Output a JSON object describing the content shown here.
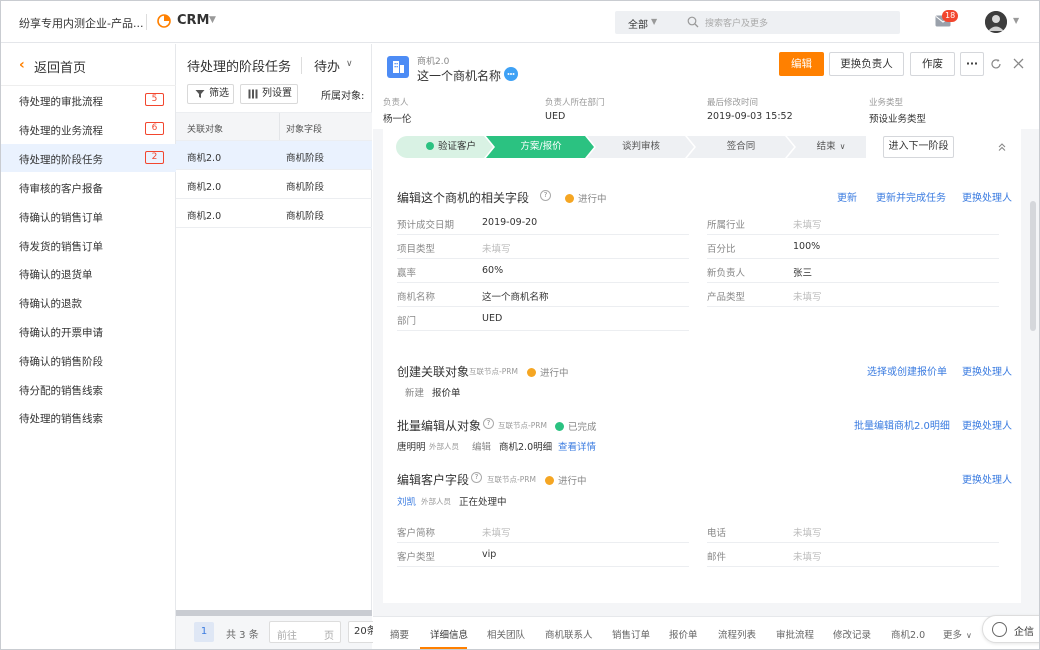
{
  "topbar": {
    "company": "纷享专用内测企业-产品...",
    "app_name": "CRM",
    "search_scope": "全部",
    "search_placeholder": "搜索客户及更多",
    "mail_badge": "18"
  },
  "sidebar": {
    "back_label": "返回首页",
    "items": [
      {
        "label": "待处理的审批流程",
        "badge": "5"
      },
      {
        "label": "待处理的业务流程",
        "badge": "6"
      },
      {
        "label": "待处理的阶段任务",
        "badge": "2"
      },
      {
        "label": "待审核的客户报备"
      },
      {
        "label": "待确认的销售订单"
      },
      {
        "label": "待发货的销售订单"
      },
      {
        "label": "待确认的退货单"
      },
      {
        "label": "待确认的退款"
      },
      {
        "label": "待确认的开票申请"
      },
      {
        "label": "待确认的销售阶段"
      },
      {
        "label": "待分配的销售线索"
      },
      {
        "label": "待处理的销售线索"
      }
    ],
    "active_index": 2
  },
  "list": {
    "title": "待处理的阶段任务",
    "filter_label": "待办",
    "filter_btn": "筛选",
    "column_btn": "列设置",
    "belong_label": "所属对象:",
    "columns": [
      "关联对象",
      "对象字段"
    ],
    "rows": [
      [
        "商机2.0",
        "商机阶段"
      ],
      [
        "商机2.0",
        "商机阶段"
      ],
      [
        "商机2.0",
        "商机阶段"
      ]
    ],
    "pager": {
      "page": "1",
      "total": "共 3 条",
      "goto_placeholder": "前往",
      "page_unit": "页",
      "page_size": "20条"
    }
  },
  "detail": {
    "object_type": "商机2.0",
    "object_name": "这一个商机名称",
    "actions": {
      "edit": "编辑",
      "change_owner": "更换负责人",
      "void": "作废",
      "more": "···"
    },
    "meta": [
      {
        "k": "负责人",
        "v": "杨一伦"
      },
      {
        "k": "负责人所在部门",
        "v": "UED"
      },
      {
        "k": "最后修改时间",
        "v": "2019-09-03 15:52"
      },
      {
        "k": "业务类型",
        "v": "预设业务类型"
      }
    ],
    "stages": [
      "验证客户",
      "方案/报价",
      "谈判审核",
      "签合同",
      "结束"
    ],
    "next_stage": "进入下一阶段",
    "section1": {
      "title": "编辑这个商机的相关字段",
      "status": "进行中",
      "links": [
        "更新",
        "更新并完成任务",
        "更换处理人"
      ],
      "left_fields": [
        {
          "k": "预计成交日期",
          "v": "2019-09-20"
        },
        {
          "k": "项目类型",
          "v": "未填写"
        },
        {
          "k": "赢率",
          "v": "60%"
        },
        {
          "k": "商机名称",
          "v": "这一个商机名称"
        },
        {
          "k": "部门",
          "v": "UED"
        }
      ],
      "right_fields": [
        {
          "k": "所属行业",
          "v": "未填写"
        },
        {
          "k": "百分比",
          "v": "100%"
        },
        {
          "k": "新负责人",
          "v": "张三"
        },
        {
          "k": "产品类型",
          "v": "未填写"
        }
      ]
    },
    "section2": {
      "title": "创建关联对象",
      "node": "互联节点-PRM",
      "status": "进行中",
      "links": [
        "选择或创建报价单",
        "更换处理人"
      ],
      "new_label": "新建",
      "object": "报价单"
    },
    "section3": {
      "title": "批量编辑从对象",
      "node": "互联节点-PRM",
      "status": "已完成",
      "links": [
        "批量编辑商机2.0明细",
        "更换处理人"
      ],
      "person": "唐明明",
      "person_tag": "外部人员",
      "action": "编辑",
      "object": "商机2.0明细",
      "view": "查看详情"
    },
    "section4": {
      "title": "编辑客户字段",
      "node": "互联节点-PRM",
      "status": "进行中",
      "links": [
        "更换处理人"
      ],
      "person": "刘凯",
      "person_tag": "外部人员",
      "state": "正在处理中",
      "left_fields": [
        {
          "k": "客户简称",
          "v": "未填写"
        },
        {
          "k": "客户类型",
          "v": "vip"
        }
      ],
      "right_fields": [
        {
          "k": "电话",
          "v": "未填写"
        },
        {
          "k": "邮件",
          "v": "未填写"
        }
      ]
    },
    "tabs": [
      "摘要",
      "详细信息",
      "相关团队",
      "商机联系人",
      "销售订单",
      "报价单",
      "流程列表",
      "审批流程",
      "修改记录",
      "商机2.0",
      "更多"
    ],
    "active_tab": 1
  },
  "qixin": "企信",
  "colors": {
    "accent": "#ff8000",
    "link": "#3a7be0",
    "stage_done": "#d9f2e4",
    "stage_active": "#2bc281",
    "badge_red": "#f2462e"
  }
}
